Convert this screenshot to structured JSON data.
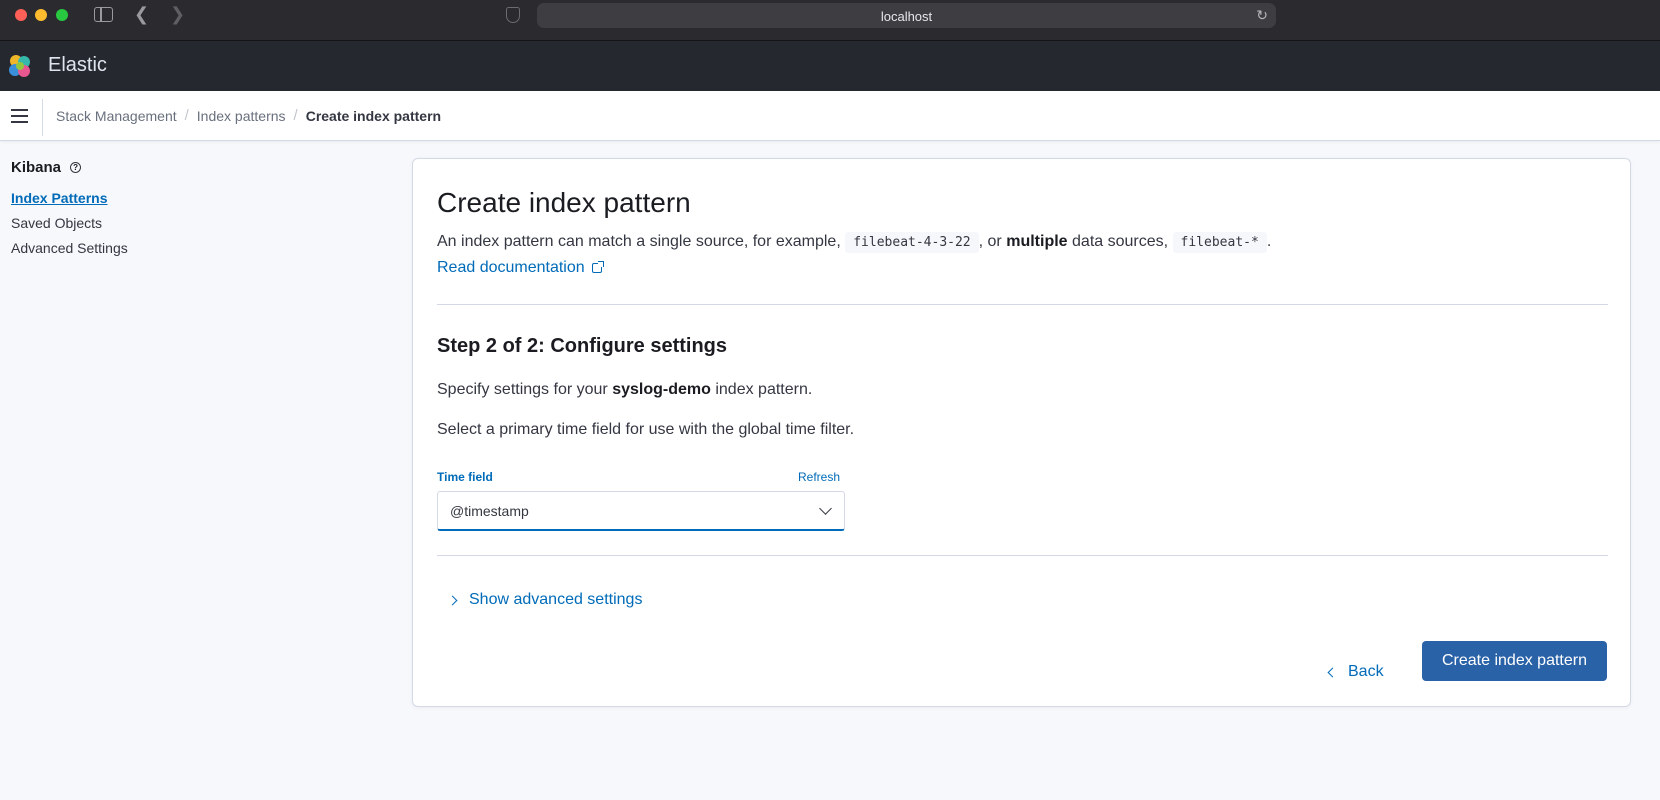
{
  "browser": {
    "url": "localhost"
  },
  "header": {
    "app_title": "Elastic",
    "logo_icon": "elastic-logo"
  },
  "breadcrumbs": {
    "items": [
      "Stack Management",
      "Index patterns"
    ],
    "current": "Create index pattern",
    "separator": "/"
  },
  "sidebar": {
    "title": "Kibana",
    "items": [
      {
        "label": "Index Patterns",
        "active": true
      },
      {
        "label": "Saved Objects",
        "active": false
      },
      {
        "label": "Advanced Settings",
        "active": false
      }
    ]
  },
  "main": {
    "title": "Create index pattern",
    "description": {
      "part1": "An index pattern can match a single source, for example,",
      "code1": "filebeat-4-3-22",
      "part2": ", or",
      "bold": "multiple",
      "part3": "data sources,",
      "code2": "filebeat-*",
      "part4": "."
    },
    "doc_link": "Read documentation",
    "step_title": "Step 2 of 2: Configure settings",
    "spec": {
      "prefix": "Specify settings for your",
      "pattern_name": "syslog-demo",
      "suffix": "index pattern."
    },
    "select_text": "Select a primary time field for use with the global time filter.",
    "time_field": {
      "label": "Time field",
      "refresh_label": "Refresh",
      "value": "@timestamp"
    },
    "advanced_toggle": "Show advanced settings",
    "back_label": "Back",
    "create_label": "Create index pattern"
  },
  "colors": {
    "link": "#006bb8",
    "primary_button": "#2a62a8",
    "header_bg": "#25282f"
  }
}
